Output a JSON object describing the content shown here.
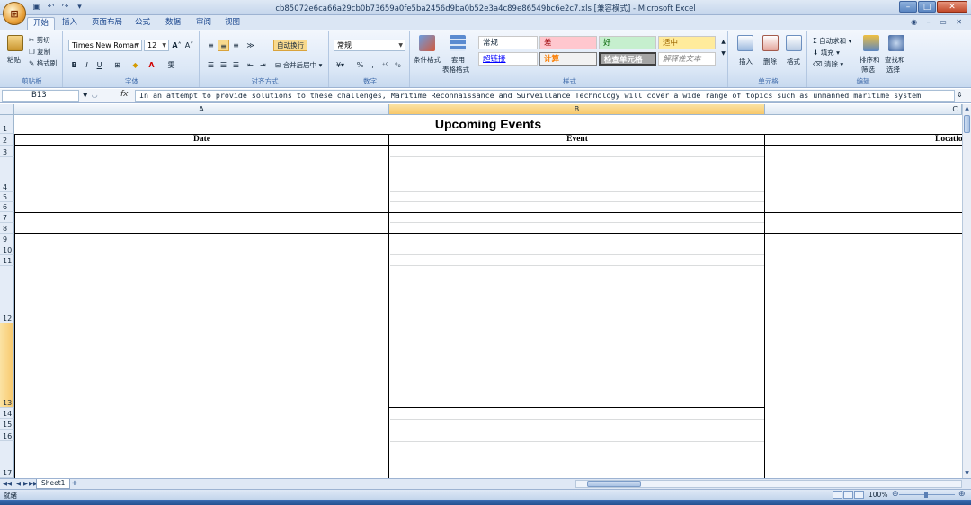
{
  "window": {
    "title": "cb85072e6ca66a29cb0b73659a0fe5ba2456d9ba0b52e3a4c89e86549bc6e2c7.xls  [兼容模式] - Microsoft Excel",
    "minimize": "–",
    "maximize": "□",
    "close": "✕"
  },
  "ribbon_tabs": [
    "开始",
    "插入",
    "页面布局",
    "公式",
    "数据",
    "审阅",
    "视图"
  ],
  "ribbon": {
    "clipboard": {
      "paste": "粘贴",
      "cut": "剪切",
      "copy": "复制",
      "format_painter": "格式刷",
      "label": "剪贴板"
    },
    "font": {
      "name": "Times New Roman",
      "size": "12",
      "label": "字体",
      "bold": "B",
      "italic": "I",
      "underline": "U"
    },
    "alignment": {
      "wrap": "自动换行",
      "merge": "合并后居中",
      "label": "对齐方式"
    },
    "number": {
      "format": "常规",
      "percent": "%",
      "comma": ",",
      "label": "数字"
    },
    "styles": {
      "conditional": "条件格式",
      "table": "套用",
      "table2": "表格格式",
      "normal": "常规",
      "bad": "差",
      "good": "好",
      "neutral": "适中",
      "hyperlink": "超链接",
      "calculation": "计算",
      "check_cell": "检查单元格",
      "explanatory": "解释性文本",
      "label": "样式"
    },
    "cells": {
      "insert": "插入",
      "delete": "删除",
      "format": "格式",
      "label": "单元格"
    },
    "editing": {
      "autosum": "自动求和",
      "fill": "填充",
      "clear": "清除",
      "sort": "排序和",
      "sort2": "筛选",
      "find": "查找和",
      "find2": "选择",
      "label": "编辑"
    }
  },
  "formula_bar": {
    "name_box": "B13",
    "fx": "fx",
    "content": "In an attempt to provide solutions to these challenges, Maritime Reconnaissance and Surveillance Technology will cover a wide range of topics such as unmanned maritime system"
  },
  "columns": [
    "A",
    "B",
    "C"
  ],
  "rows": [
    "1",
    "2",
    "3",
    "4",
    "5",
    "6",
    "7",
    "8",
    "9",
    "10",
    "11",
    "12",
    "13",
    "14",
    "15",
    "16",
    "17"
  ],
  "sheet": {
    "title": "Upcoming Events",
    "header_date": "Date",
    "header_event": "Event",
    "header_location": "Location"
  },
  "sheet_tabs": [
    "Sheet1"
  ],
  "status": {
    "ready": "就绪",
    "zoom": "100%"
  }
}
